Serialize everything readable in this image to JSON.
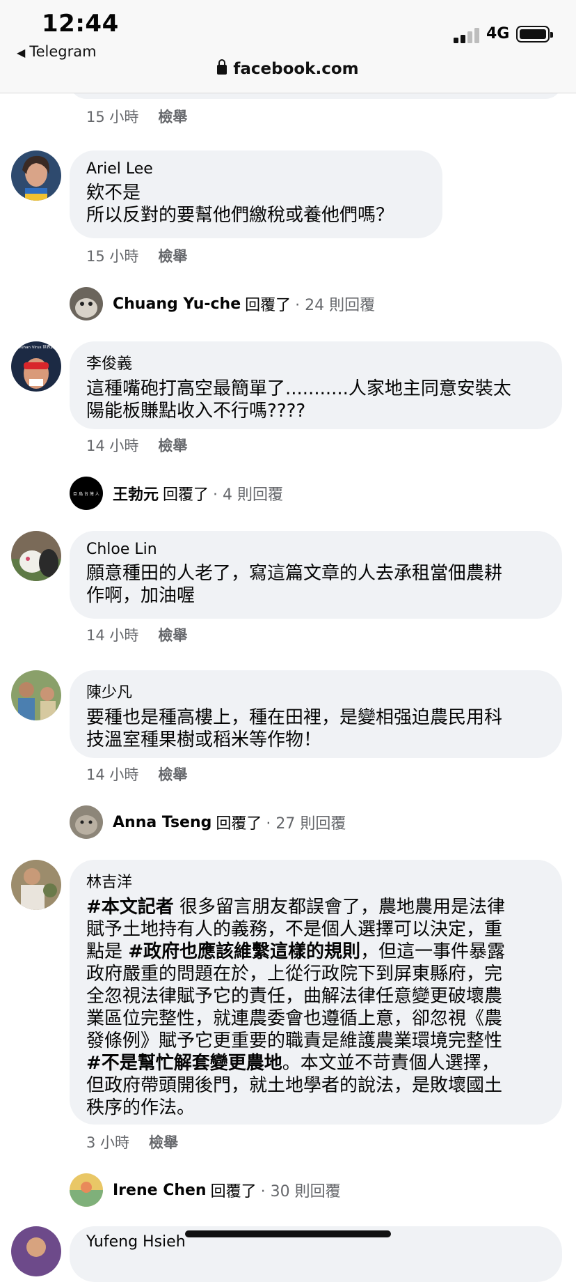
{
  "status_bar": {
    "time": "12:44",
    "back_app": "Telegram",
    "network": "4G",
    "url": "facebook.com"
  },
  "first_meta": {
    "time": "15 小時",
    "report": "檢舉"
  },
  "comments": [
    {
      "author": "Ariel Lee",
      "lines": [
        "欸不是",
        "所以反對的要幫他們繳稅或養他們嗎？"
      ],
      "time": "15 小時",
      "report": "檢舉",
      "reply": {
        "name": "Chuang Yu-che",
        "verb": "回覆了",
        "count": "· 24 則回覆"
      }
    },
    {
      "author": "李俊義",
      "lines": [
        "這種嘴砲打高空最簡單了...........人家地主同意安裝太",
        "陽能板賺點收入不行嗎????"
      ],
      "time": "14 小時",
      "report": "檢舉",
      "reply": {
        "name": "王勃元",
        "verb": "回覆了",
        "count": "· 4 則回覆"
      }
    },
    {
      "author": "Chloe Lin",
      "lines": [
        "願意種田的人老了，寫這篇文章的人去承租當佃農耕",
        "作啊，加油喔"
      ],
      "time": "14 小時",
      "report": "檢舉"
    },
    {
      "author": "陳少凡",
      "lines": [
        "要種也是種高樓上，種在田裡，是變相强迫農民用科",
        "技溫室種果樹或稻米等作物！"
      ],
      "time": "14 小時",
      "report": "檢舉",
      "reply": {
        "name": "Anna Tseng",
        "verb": "回覆了",
        "count": "· 27 則回覆"
      }
    },
    {
      "author": "林吉洋",
      "segments": {
        "tag1": "#本文記者",
        "t1": " 很多留言朋友都誤會了，農地農用是法律\n賦予土地持有人的義務，不是個人選擇可以決定，重\n點是 ",
        "tag2": "#政府也應該維繫這樣的規則",
        "t2": "，但這一事件暴露\n政府嚴重的問題在於，上從行政院下到屏東縣府，完\n全忽視法律賦予它的責任，曲解法律任意變更破壞農\n業區位完整性，就連農委會也遵循上意，卻忽視《農\n發條例》賦予它更重要的職責是維護農業環境完整性\n",
        "tag3": "#不是幫忙解套變更農地",
        "t3": "。本文並不苛責個人選擇，\n但政府帶頭開後門，就土地學者的說法，是敗壞國土\n秩序的作法。"
      },
      "time": "3 小時",
      "report": "檢舉",
      "reply": {
        "name": "Irene Chen",
        "verb": "回覆了",
        "count": "· 30 則回覆"
      }
    },
    {
      "author": "Yufeng Hsieh"
    }
  ],
  "avatar_labels": {
    "li": "Father of Wuhan Virus 世界武漢肺炎之父",
    "wang": "亞 烏 台 灣 人"
  }
}
